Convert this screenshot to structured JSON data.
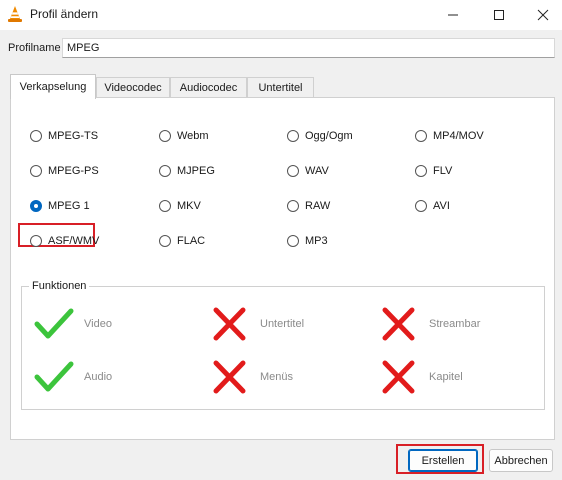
{
  "window": {
    "title": "Profil ändern",
    "app_icon": "vlc-cone-icon",
    "controls": [
      "minimize-icon",
      "maximize-icon",
      "close-icon"
    ]
  },
  "profile": {
    "label": "Profilname",
    "value": "MPEG"
  },
  "tabs": [
    {
      "label": "Verkapselung",
      "active": true
    },
    {
      "label": "Videocodec",
      "active": false
    },
    {
      "label": "Audiocodec",
      "active": false
    },
    {
      "label": "Untertitel",
      "active": false
    }
  ],
  "encapsulation": {
    "options": [
      {
        "label": "MPEG-TS",
        "checked": false
      },
      {
        "label": "Webm",
        "checked": false
      },
      {
        "label": "Ogg/Ogm",
        "checked": false
      },
      {
        "label": "MP4/MOV",
        "checked": false
      },
      {
        "label": "MPEG-PS",
        "checked": false
      },
      {
        "label": "MJPEG",
        "checked": false
      },
      {
        "label": "WAV",
        "checked": false
      },
      {
        "label": "FLV",
        "checked": false
      },
      {
        "label": "MPEG 1",
        "checked": true
      },
      {
        "label": "MKV",
        "checked": false
      },
      {
        "label": "RAW",
        "checked": false
      },
      {
        "label": "AVI",
        "checked": false
      },
      {
        "label": "ASF/WMV",
        "checked": false
      },
      {
        "label": "FLAC",
        "checked": false
      },
      {
        "label": "MP3",
        "checked": false
      }
    ]
  },
  "features": {
    "title": "Funktionen",
    "items": [
      {
        "label": "Video",
        "supported": true
      },
      {
        "label": "Untertitel",
        "supported": false
      },
      {
        "label": "Streambar",
        "supported": false
      },
      {
        "label": "Audio",
        "supported": true
      },
      {
        "label": "Menüs",
        "supported": false
      },
      {
        "label": "Kapitel",
        "supported": false
      }
    ]
  },
  "buttons": {
    "create": "Erstellen",
    "cancel": "Abbrechen"
  },
  "colors": {
    "highlight": "#d81f26",
    "check": "#3cc43c",
    "cross": "#e21b1b",
    "accent": "#0067c0"
  }
}
